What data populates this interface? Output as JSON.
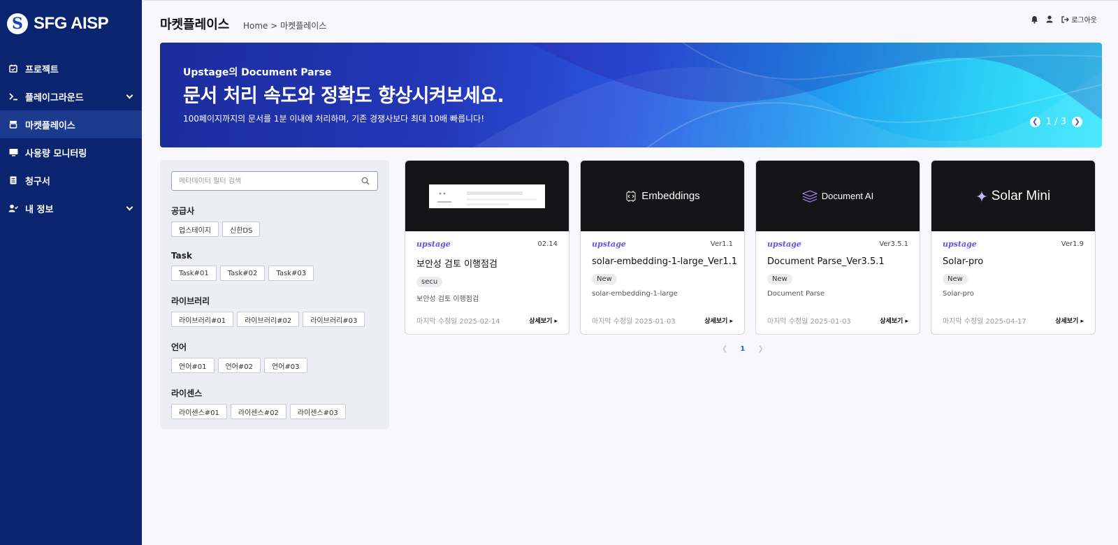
{
  "app": {
    "logo_text": "SFG AISP"
  },
  "sidebar": {
    "items": [
      {
        "label": "프로젝트",
        "icon": "calendar-check-icon"
      },
      {
        "label": "플레이그라운드",
        "icon": "terminal-icon",
        "expandable": true
      },
      {
        "label": "마켓플레이스",
        "icon": "store-icon",
        "active": true
      },
      {
        "label": "사용량 모니터링",
        "icon": "monitor-icon"
      },
      {
        "label": "청구서",
        "icon": "receipt-icon"
      },
      {
        "label": "내 정보",
        "icon": "user-check-icon",
        "expandable": true
      }
    ]
  },
  "header": {
    "title": "마켓플레이스",
    "breadcrumb": "Home > 마켓플레이스",
    "logout_label": "로그아웃"
  },
  "banner": {
    "kicker": "Upstage의 Document Parse",
    "title": "문서 처리 속도와 정확도 향상시켜보세요.",
    "description": "100페이지까지의 문서를 1분 이내에 처리하며, 기존 경쟁사보다 최대 10배 빠릅니다!",
    "pager": "1 / 3"
  },
  "filter": {
    "search_placeholder": "메타데이터 필터 검색",
    "groups": [
      {
        "title": "공급사",
        "chips": [
          "업스테이지",
          "신한DS"
        ]
      },
      {
        "title": "Task",
        "chips": [
          "Task#01",
          "Task#02",
          "Task#03"
        ]
      },
      {
        "title": "라이브러리",
        "chips": [
          "라이브러리#01",
          "라이브러리#02",
          "라이브러리#03"
        ]
      },
      {
        "title": "언어",
        "chips": [
          "언어#01",
          "언어#02",
          "언어#03"
        ]
      },
      {
        "title": "라이센스",
        "chips": [
          "라이센스#01",
          "라이센스#02",
          "라이센스#03"
        ]
      }
    ]
  },
  "cards": [
    {
      "thumb": "",
      "vendor": "upstage",
      "version": "02.14",
      "title": "보안성 검토 이행점검",
      "tag": "secu",
      "desc": "보안성 검토 이행점검",
      "modified": "마지막 수정일 2025-02-14",
      "detail": "상세보기"
    },
    {
      "thumb": "Embeddings",
      "vendor": "upstage",
      "version": "Ver1.1",
      "title": "solar-embedding-1-large_Ver1.1",
      "tag": "New",
      "desc": "solar-embedding-1-large",
      "modified": "마지막 수정일 2025-01-03",
      "detail": "상세보기"
    },
    {
      "thumb": "Document AI",
      "vendor": "upstage",
      "version": "Ver3.5.1",
      "title": "Document Parse_Ver3.5.1",
      "tag": "New",
      "desc": "Document Parse",
      "modified": "마지막 수정일 2025-01-03",
      "detail": "상세보기"
    },
    {
      "thumb": "Solar Mini",
      "vendor": "upstage",
      "version": "Ver1.9",
      "title": "Solar-pro",
      "tag": "New",
      "desc": "Solar-pro",
      "modified": "마지막 수정일 2025-04-17",
      "detail": "상세보기"
    }
  ],
  "pagination": {
    "current": "1"
  },
  "colors": {
    "sidebar": "#0a2470",
    "sidebar_active": "#1c3a8e",
    "vendor": "#6a4ce6",
    "page_link": "#1a6fd8"
  }
}
